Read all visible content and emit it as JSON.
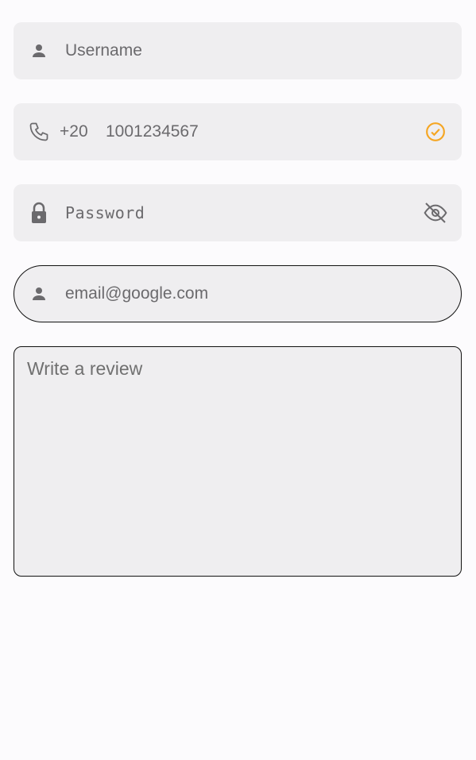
{
  "username": {
    "placeholder": "Username",
    "icon": "person-icon"
  },
  "phone": {
    "country_code": "+20",
    "value": "1001234567",
    "icon": "phone-icon",
    "status_icon": "check-circle-icon",
    "status_color": "#f5a623"
  },
  "password": {
    "placeholder": "Password",
    "icon": "lock-icon",
    "toggle_icon": "eye-off-icon"
  },
  "email": {
    "value": "email@google.com",
    "icon": "person-icon"
  },
  "review": {
    "placeholder": "Write a review"
  }
}
